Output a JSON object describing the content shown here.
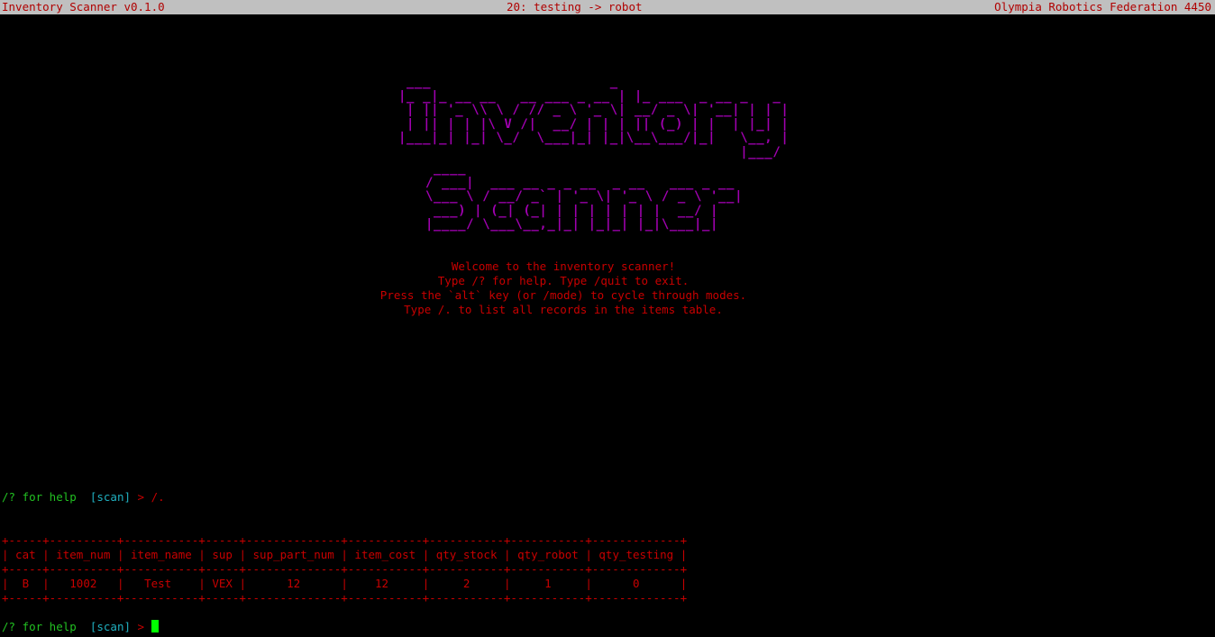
{
  "status_bar": {
    "app_title": "Inventory Scanner v0.1.0",
    "transfer": "20: testing -> robot",
    "organization": "Olympia Robotics Federation 4450"
  },
  "banner": {
    "word1": "Inventory",
    "word2": "Scanner",
    "art1": " ___                      _\n|_ _|_ __ __   __ ___ _ __ | |_ ___  _ __ _   _\n | || '_ \\\\ \\ / // _ \\ '_ \\| __/ _ \\| '__| | | |\n | || | | |\\ V /|  __/ | | | || (_) | |  | |_| |\n|___|_| |_| \\_/  \\___|_| |_|\\__\\___/|_|   \\__, |\n                                          |___/",
    "art2": " ____\n/ ___|  ___ __ _ _ __  _ __   ___ _ __\n\\___ \\ / __/ _` | '_ \\| '_ \\ / _ \\ '__|\n ___) | (_| (_| | | | | | | |  __/ |\n|____/ \\___\\__,_|_| |_|_| |_|\\___|_|"
  },
  "welcome": {
    "line1": "Welcome to the inventory scanner!",
    "line2": "Type /? for help. Type /quit to exit.",
    "line3": "Press the `alt` key (or /mode) to cycle through modes.",
    "line4": "Type /. to list all records in the items table."
  },
  "history_prompt": {
    "help": "/? for help",
    "mode": "[scan]",
    "arrow": ">",
    "command": "/."
  },
  "items_table": {
    "columns": [
      "cat",
      "item_num",
      "item_name",
      "sup",
      "sup_part_num",
      "item_cost",
      "qty_stock",
      "qty_robot",
      "qty_testing"
    ],
    "rows": [
      [
        "B",
        "1002",
        "Test",
        "VEX",
        "12",
        "12",
        "2",
        "1",
        "0"
      ]
    ]
  },
  "active_prompt": {
    "help": "/? for help",
    "mode": "[scan]",
    "arrow": ">",
    "input_value": ""
  },
  "colors": {
    "banner": "#a000b0",
    "text": "#c80000",
    "help_prompt": "#22c022",
    "mode_prompt": "#20b0c0",
    "status_bar_bg": "#c0c0c0",
    "cursor": "#00ff00"
  }
}
